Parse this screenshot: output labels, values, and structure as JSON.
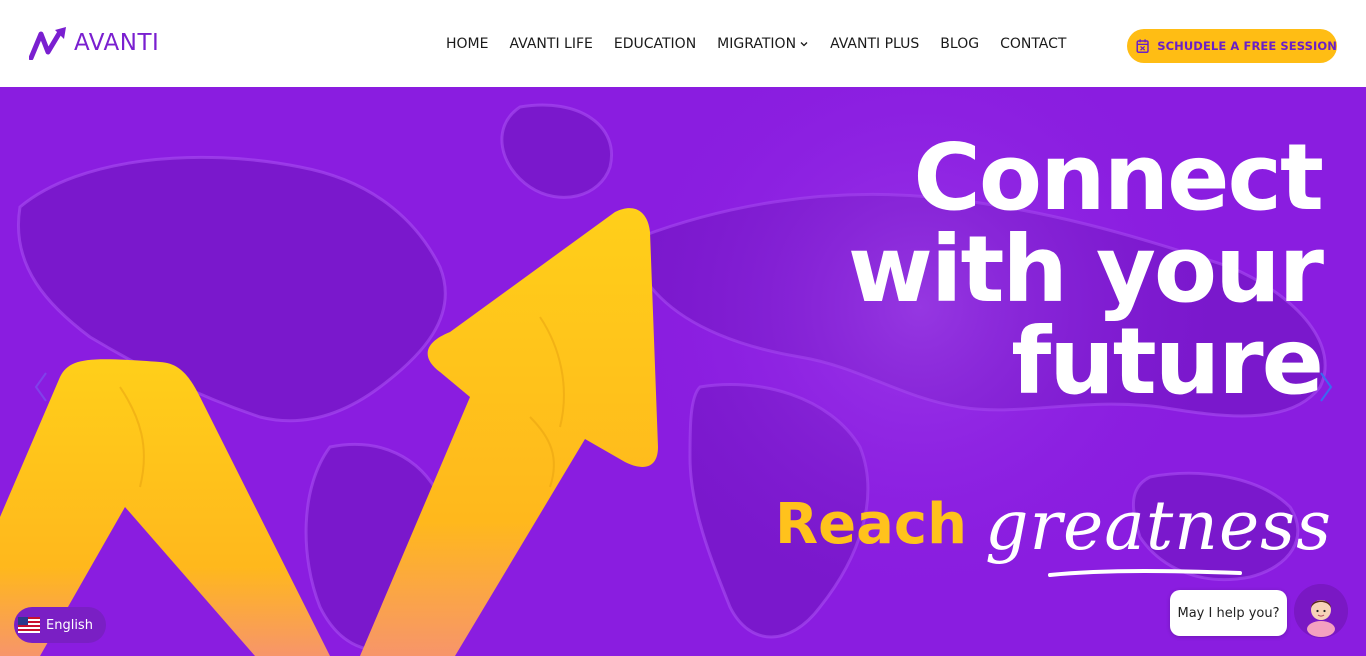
{
  "logo": {
    "name": "AVANTI"
  },
  "nav": {
    "items": [
      {
        "label": "HOME"
      },
      {
        "label": "AVANTI LIFE"
      },
      {
        "label": "EDUCATION"
      },
      {
        "label": "MIGRATION"
      },
      {
        "label": "AVANTI PLUS"
      },
      {
        "label": "BLOG"
      },
      {
        "label": "CONTACT"
      }
    ]
  },
  "cta": {
    "label": "SCHUDELE A FREE SESSION",
    "icon": "calendar-icon"
  },
  "hero": {
    "headline": [
      "Connect",
      "with your",
      "future"
    ],
    "tagline_reach": "Reach",
    "tagline_greatness": "greatness"
  },
  "language": {
    "label": "English",
    "icon": "us-flag-icon"
  },
  "chat": {
    "prompt": "May I help you?"
  },
  "colors": {
    "brand_purple": "#8a1de0",
    "accent_yellow": "#ffc21c",
    "cta_yellow": "#ffbd14",
    "logo_purple": "#7a1fd0"
  }
}
